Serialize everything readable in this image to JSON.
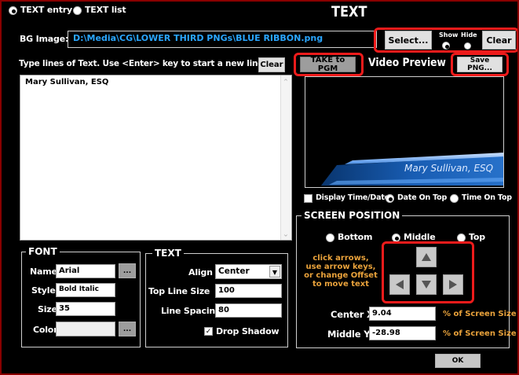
{
  "title": "TEXT",
  "mode": {
    "option1": "TEXT entry",
    "option2": "TEXT list",
    "selected": "TEXT entry"
  },
  "bg_image": {
    "label": "BG Image:",
    "path": "D:\\Media\\CG\\LOWER THIRD PNGs\\BLUE RIBBON.png",
    "select_label": "Select...",
    "show_label": "Show",
    "hide_label": "Hide",
    "clear_label": "Clear"
  },
  "text_entry": {
    "instructions": "Type lines of Text.  Use <Enter> key to start a new line.",
    "clear_label": "Clear",
    "content": "Mary Sullivan, ESQ"
  },
  "preview": {
    "take_label": "TAKE to PGM",
    "title": "Video Preview",
    "save_label": "Save PNG...",
    "ribbon_text": "Mary Sullivan, ESQ",
    "display_time_label": "Display Time/Date",
    "date_on_top": "Date On Top",
    "time_on_top": "Time On Top"
  },
  "font": {
    "legend": "FONT",
    "name_label": "Name",
    "name_value": "Arial",
    "style_label": "Style",
    "style_value": "Bold Italic",
    "size_label": "Size",
    "size_value": "35",
    "color_label": "Color",
    "browse": "..."
  },
  "text_settings": {
    "legend": "TEXT",
    "align_label": "Align",
    "align_value": "Center",
    "top_line_label": "Top Line Size",
    "top_line_value": "100",
    "line_spacing_label": "Line Spacing",
    "line_spacing_value": "80",
    "drop_shadow_label": "Drop Shadow"
  },
  "screen_position": {
    "legend": "SCREEN POSITION",
    "bottom": "Bottom",
    "middle": "Middle",
    "top": "Top",
    "selected": "Middle",
    "hint": [
      "click arrows,",
      "use arrow keys,",
      "or change Offset",
      "to move text"
    ],
    "center_x_label": "Center X:",
    "center_x_value": "9.04",
    "middle_y_label": "Middle Y:",
    "middle_y_value": "-28.98",
    "percent_label": "% of Screen Size"
  },
  "ok_label": "OK",
  "colors": {
    "accent_red": "#ee1b1b",
    "hint_orange": "#e9a23b",
    "path_blue": "#2aa6ff"
  }
}
